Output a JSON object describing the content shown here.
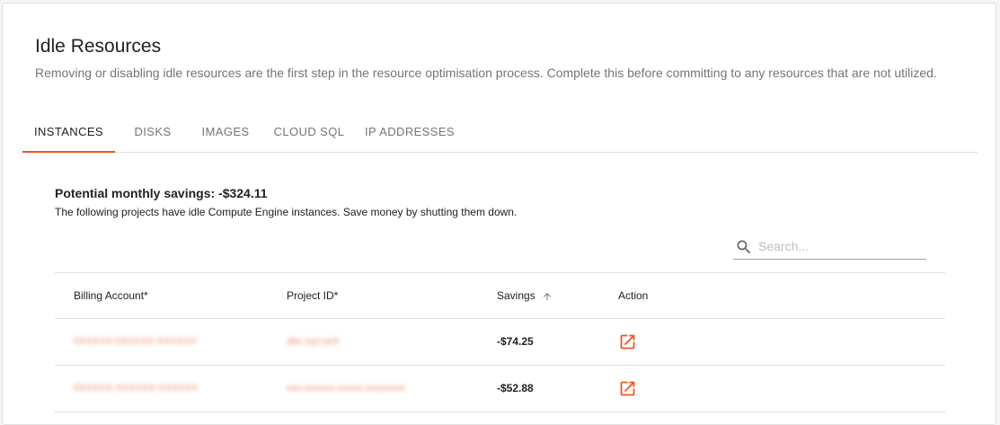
{
  "header": {
    "title": "Idle Resources",
    "description": "Removing or disabling idle resources are the first step in the resource optimisation process. Complete this before committing to any resources that are not utilized."
  },
  "tabs": [
    {
      "label": "INSTANCES",
      "active": true
    },
    {
      "label": "DISKS",
      "active": false
    },
    {
      "label": "IMAGES",
      "active": false
    },
    {
      "label": "CLOUD SQL",
      "active": false
    },
    {
      "label": "IP ADDRESSES",
      "active": false
    }
  ],
  "summary": {
    "title": "Potential monthly savings: -$324.11",
    "description": "The following projects have idle Compute Engine instances. Save money by shutting them down."
  },
  "search": {
    "placeholder": "Search...",
    "value": ""
  },
  "table": {
    "columns": [
      "Billing Account*",
      "Project ID*",
      "Savings",
      "Action"
    ],
    "rows": [
      {
        "billing_account": "0XXXXX-0XXXXX-XXXXXX",
        "project_id": "abc-xyz-prd",
        "savings": "-$74.25"
      },
      {
        "billing_account": "0XXXXX-XXXXXX-XXXXXX",
        "project_id": "xxx-xxxxxx-xxxxx-xxxxxxxx",
        "savings": "-$52.88"
      }
    ]
  },
  "colors": {
    "accent": "#f4511e",
    "text": "#212121",
    "muted": "#757575",
    "divider": "#e0e0e0"
  },
  "icons": {
    "search": "search-icon",
    "sort": "arrow-up-icon",
    "action": "open-in-new-icon"
  }
}
